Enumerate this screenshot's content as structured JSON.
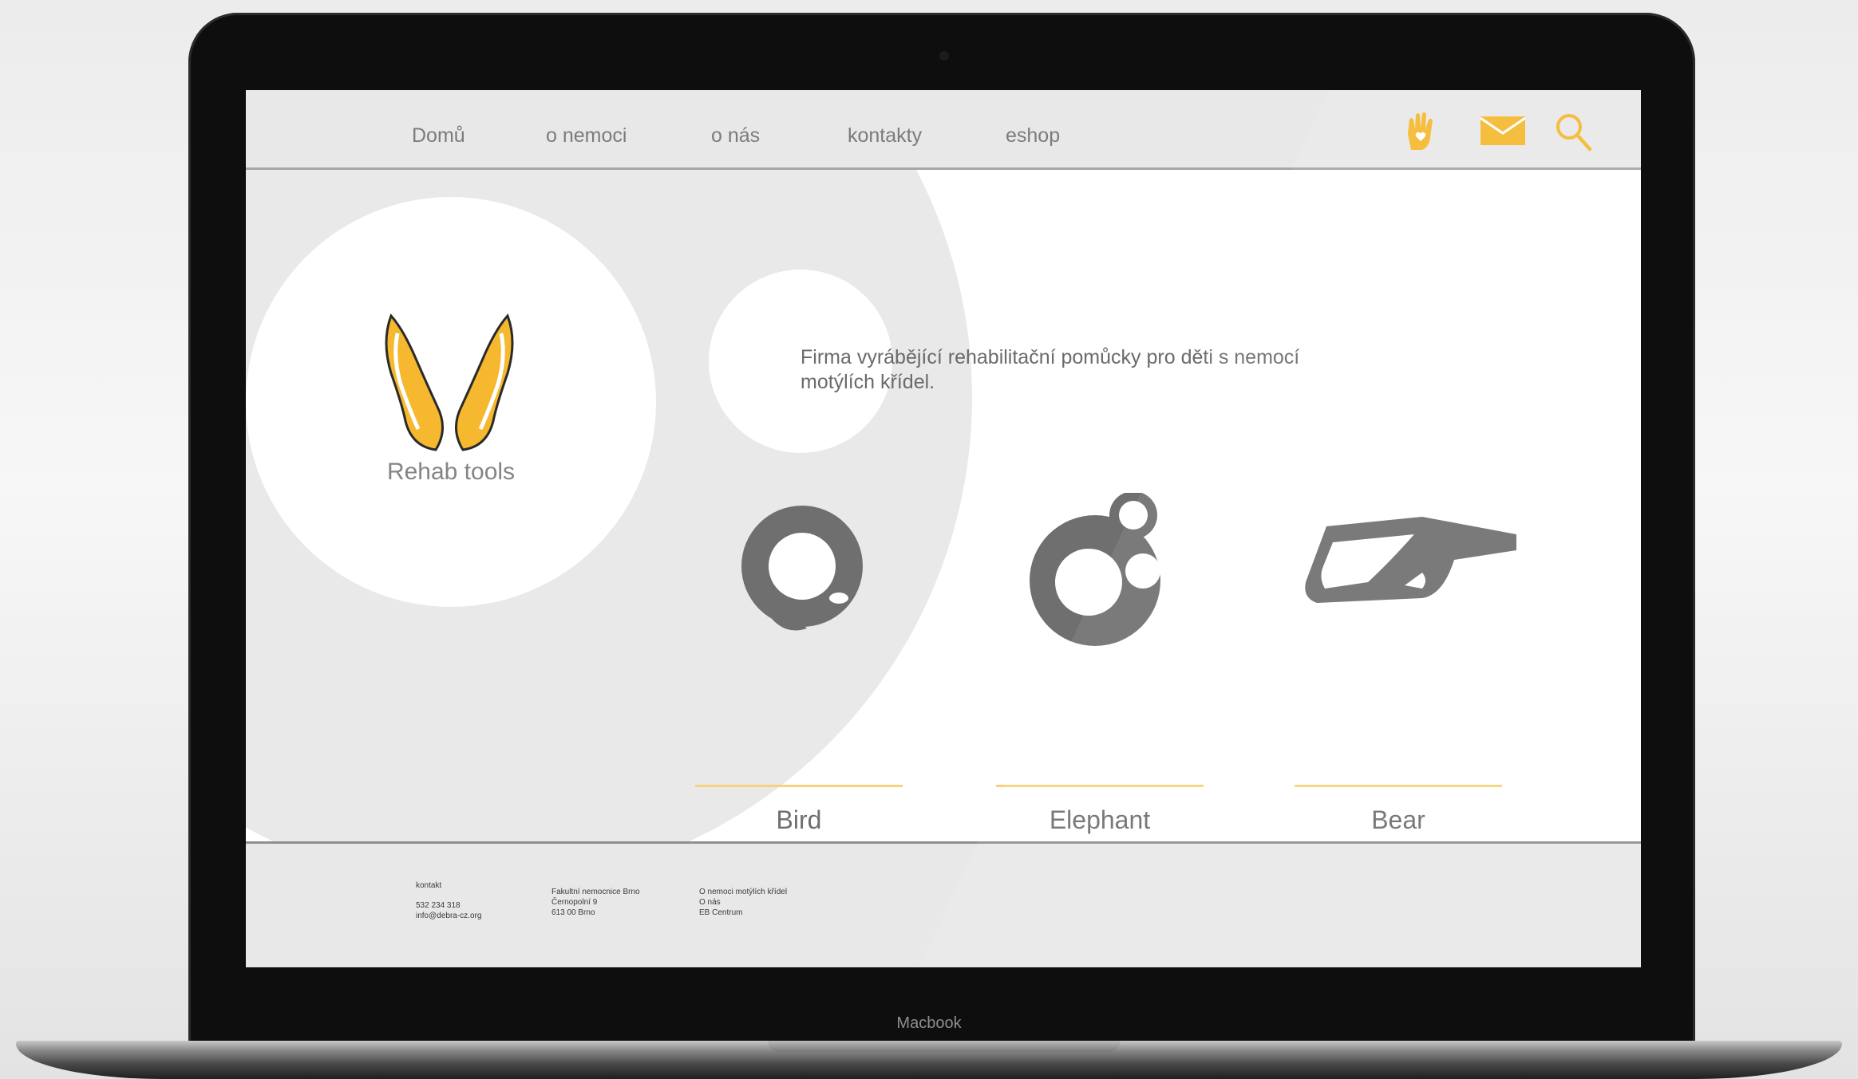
{
  "device": {
    "label": "Macbook"
  },
  "nav": {
    "items": [
      "Domů",
      "o nemoci",
      "o nás",
      "kontakty",
      "eshop"
    ],
    "icons": [
      "hand-heart-icon",
      "mail-icon",
      "search-icon"
    ],
    "accent": "#f5b82e"
  },
  "hero": {
    "logo_text": "Rehab tools",
    "tagline": "Firma vyrábějící rehabilitační pomůcky pro děti s nemocí motýlích křídel."
  },
  "products": [
    {
      "name": "Bird",
      "icon": "bird-tool-icon"
    },
    {
      "name": "Elephant",
      "icon": "elephant-tool-icon"
    },
    {
      "name": "Bear",
      "icon": "bear-tool-icon"
    }
  ],
  "footer": {
    "col1": {
      "heading": "kontakt",
      "phone": "532 234 318",
      "email": "info@debra-cz.org"
    },
    "col2": {
      "line1": "Fakultní nemocnice Brno",
      "line2": "Černopolní 9",
      "line3": "613 00 Brno"
    },
    "col3": {
      "line1": "O nemoci motýlích křídel",
      "line2": "O nás",
      "line3": "EB Centrum"
    }
  },
  "colors": {
    "accent": "#f5b82e",
    "product_gray": "#6f6f6f",
    "line": "#f6d27a"
  }
}
